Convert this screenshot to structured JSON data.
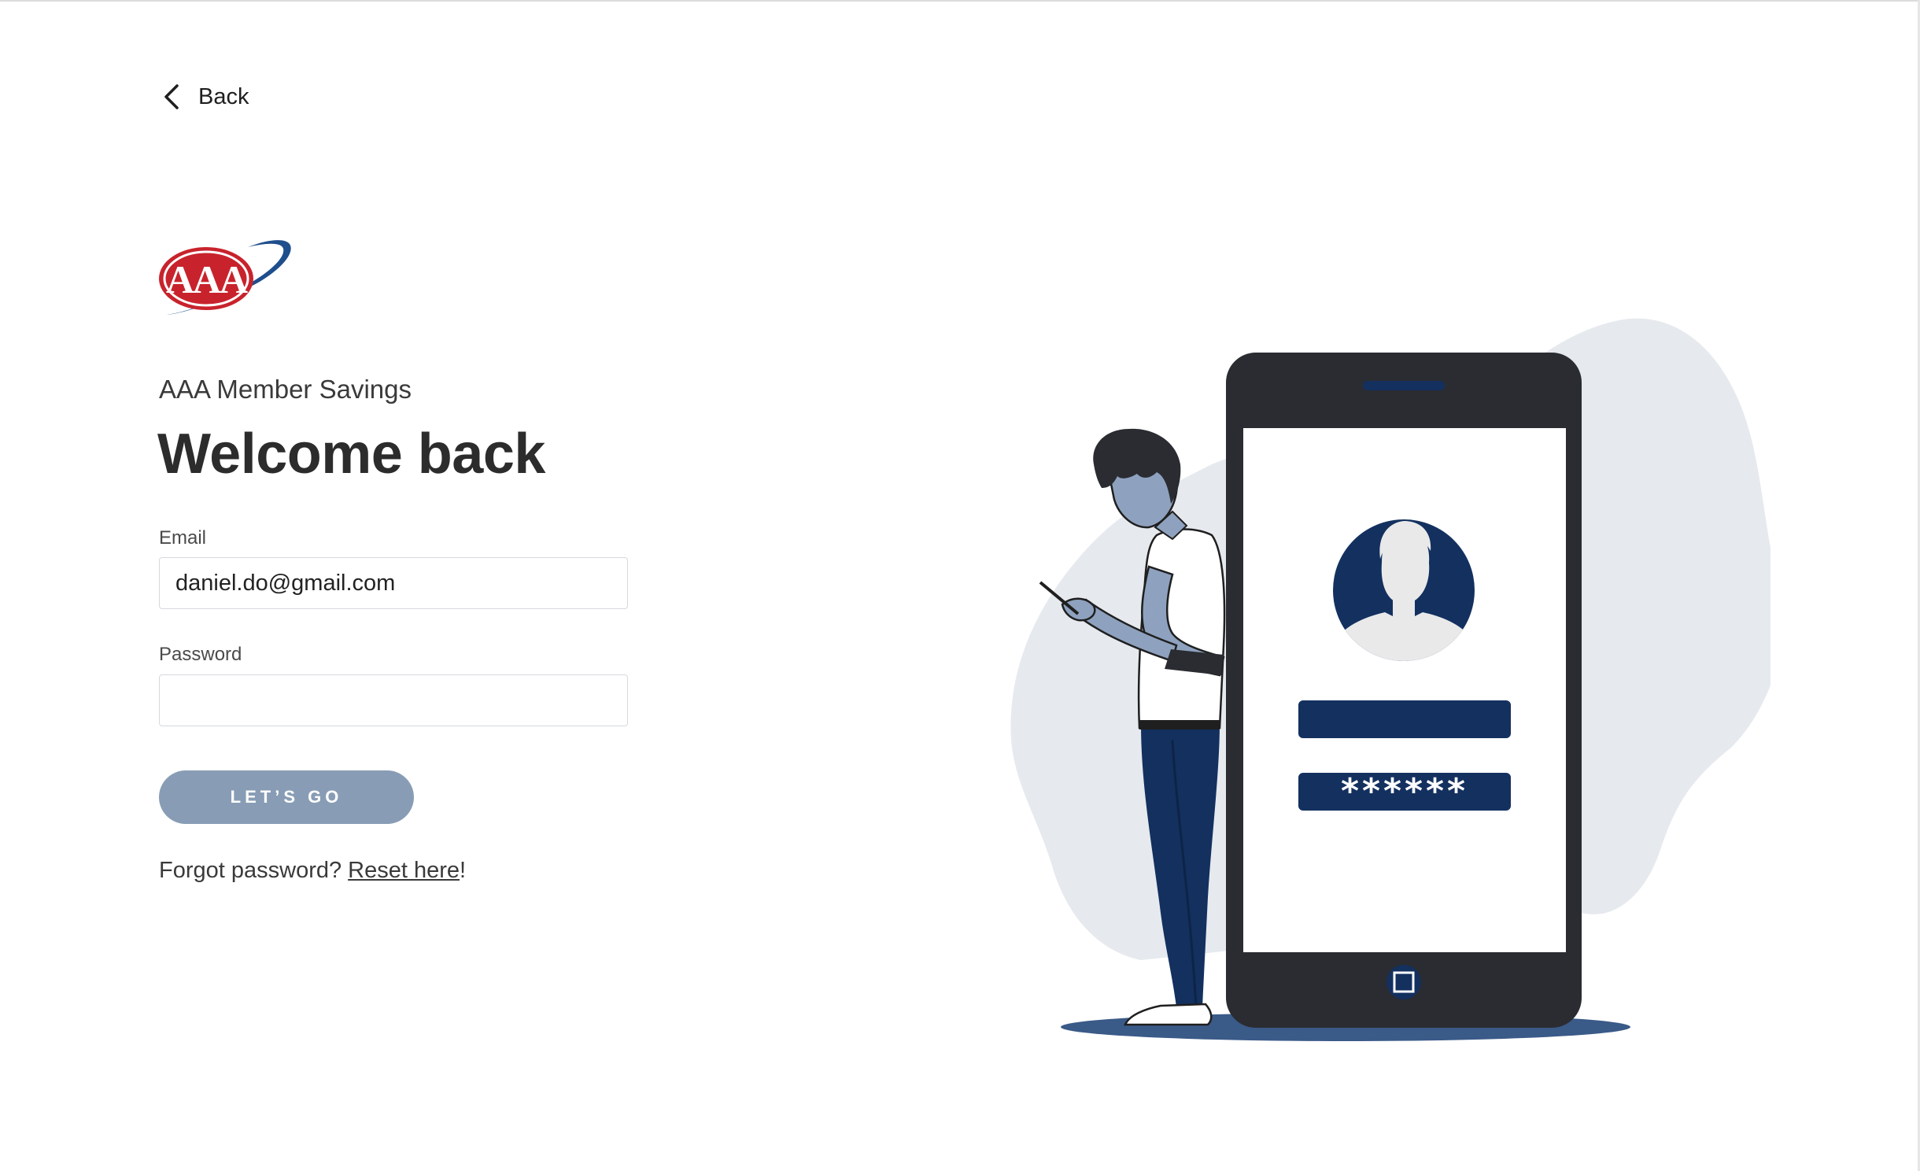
{
  "nav": {
    "back_label": "Back",
    "back_icon": "chevron-left-icon"
  },
  "brand": {
    "logo_text": "AAA",
    "logo_colors": {
      "red": "#c8232c",
      "blue": "#1f4e8c"
    }
  },
  "header": {
    "subtitle": "AAA Member Savings",
    "title": "Welcome back"
  },
  "form": {
    "email_label": "Email",
    "email_value": "daniel.do@gmail.com",
    "password_label": "Password",
    "password_value": "",
    "submit_label": "LET’S GO"
  },
  "forgot": {
    "prompt": "Forgot password? ",
    "link_label": "Reset here",
    "suffix": "!"
  },
  "illustration": {
    "password_mask": "******",
    "colors": {
      "navy": "#13305f",
      "phone": "#2a2c31",
      "blob": "#e6e9ee",
      "skin": "#8ea2bf"
    }
  }
}
